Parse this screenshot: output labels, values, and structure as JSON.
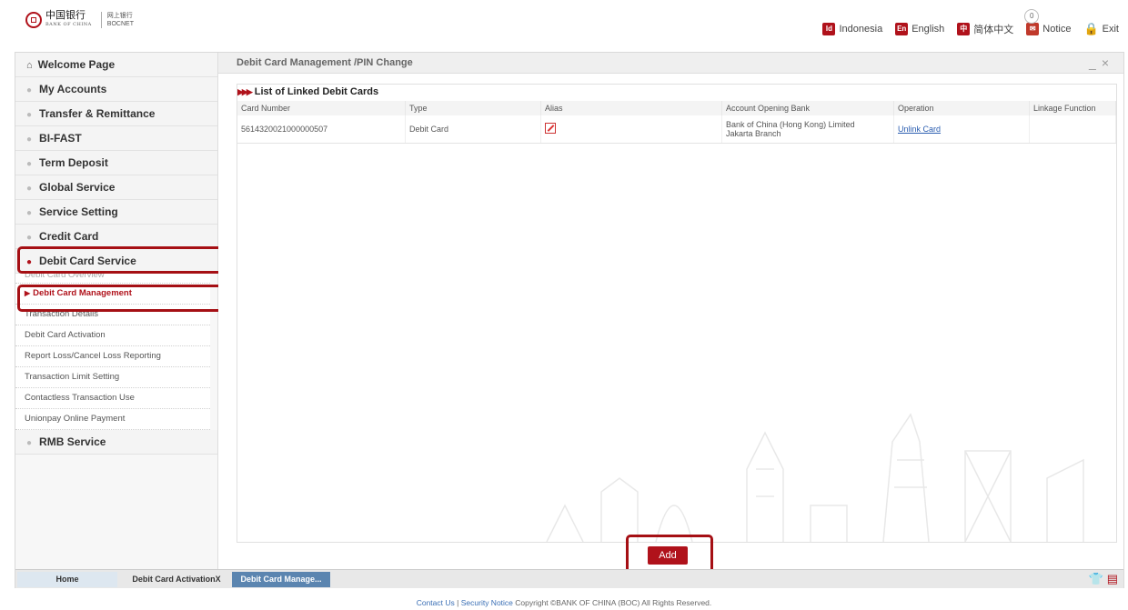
{
  "header": {
    "bank_name_cn": "中国银行",
    "bank_name_en": "BANK OF CHINA",
    "service_cn": "网上银行",
    "service_en": "BOCNET",
    "links": [
      {
        "icon": "Id",
        "label": "Indonesia"
      },
      {
        "icon": "En",
        "label": "English"
      },
      {
        "icon": "中",
        "label": "简体中文"
      }
    ],
    "notice_count": "0",
    "notice_label": "Notice",
    "exit_label": "Exit"
  },
  "sidebar": {
    "welcome": "Welcome Page",
    "items": [
      "My Accounts",
      "Transfer & Remittance",
      "BI-FAST",
      "Term Deposit",
      "Global Service",
      "Service Setting",
      "Credit Card"
    ],
    "active_item": "Debit Card Service",
    "sub_clipped": "Debit Card Overview",
    "sub_active": "Debit Card Management",
    "sub_items": [
      "Transaction Details",
      "Debit Card Activation",
      "Report Loss/Cancel Loss Reporting",
      "Transaction Limit Setting",
      "Contactless Transaction Use",
      "Unionpay Online Payment"
    ],
    "last_item": "RMB Service"
  },
  "content": {
    "title": "Debit Card Management /PIN Change",
    "list_heading": "List of Linked Debit Cards",
    "columns": [
      "Card Number",
      "Type",
      "Alias",
      "Account Opening Bank",
      "Operation",
      "Linkage Function"
    ],
    "rows": [
      {
        "card_number": "5614320021000000507",
        "type": "Debit Card",
        "bank_line1": "Bank of China (Hong Kong) Limited",
        "bank_line2": "Jakarta Branch",
        "operation": "Unlink Card",
        "linkage": ""
      }
    ],
    "add_label": "Add"
  },
  "bottom_tabs": {
    "home": "Home",
    "activation": "Debit Card ActivationX",
    "management": "Debit Card Manage..."
  },
  "footer": {
    "contact": "Contact Us",
    "separator": "|",
    "security": "Security Notice",
    "copyright": "Copyright ©BANK OF CHINA (BOC) All Rights Reserved."
  },
  "colors": {
    "brand": "#b0121b",
    "link": "#2a5db0",
    "active_tab": "#5b85b0"
  }
}
